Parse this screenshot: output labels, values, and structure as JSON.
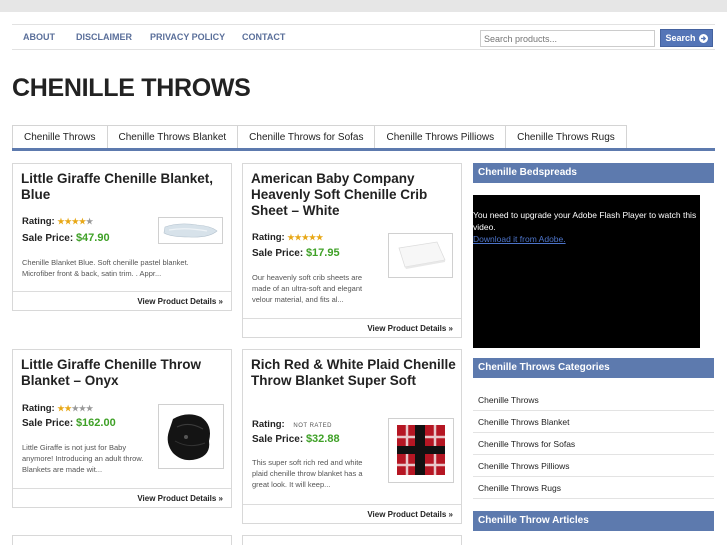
{
  "topnav": {
    "links": [
      "ABOUT",
      "DISCLAIMER",
      "PRIVACY POLICY",
      "CONTACT"
    ]
  },
  "search": {
    "placeholder": "Search products...",
    "button_label": "Search"
  },
  "site_title": "CHENILLE THROWS",
  "categories_nav": [
    "Chenille Throws",
    "Chenille Throws Blanket",
    "Chenille Throws for Sofas",
    "Chenille Throws Pilliows",
    "Chenille Throws Rugs"
  ],
  "products": [
    {
      "title": "Little Giraffe Chenille Blanket, Blue",
      "rating_label": "Rating:",
      "rating": 4,
      "price_label": "Sale Price:",
      "price": "$47.90",
      "description": "Chenille Blanket Blue. Soft chenille pastel blanket. Microfiber front & back, satin trim. . Appr...",
      "link": "View Product Details »"
    },
    {
      "title": "American Baby Company Heavenly Soft Chenille Crib Sheet – White",
      "rating_label": "Rating:",
      "rating": 5,
      "price_label": "Sale Price:",
      "price": "$17.95",
      "description": "Our heavenly soft crib sheets are made of an ultra-soft and elegant velour material, and fits al...",
      "link": "View Product Details »"
    },
    {
      "title": "Little Giraffe Chenille Throw Blanket – Onyx",
      "rating_label": "Rating:",
      "rating": 2,
      "price_label": "Sale Price:",
      "price": "$162.00",
      "description": "Little Giraffe is not just for Baby anymore! Introducing an adult throw. Blankets are made wit...",
      "link": "View Product Details »"
    },
    {
      "title": "Rich Red & White Plaid Chenille Throw Blanket Super Soft",
      "rating_label": "Rating:",
      "rating_text": "NOT RATED",
      "price_label": "Sale Price:",
      "price": "$32.88",
      "description": "This super soft rich red and white plaid chenille throw blanket has a great look. It will keep...",
      "link": "View Product Details »"
    }
  ],
  "sidebar": {
    "bedspreads_title": "Chenille Bedspreads",
    "flash_message": "You need to upgrade your Adobe Flash Player to watch this video.",
    "flash_link": "Download it from Adobe.",
    "categories_title": "Chenille Throws Categories",
    "categories": [
      "Chenille Throws",
      "Chenille Throws Blanket",
      "Chenille Throws for Sofas",
      "Chenille Throws Pilliows",
      "Chenille Throws Rugs"
    ],
    "articles_title": "Chenille Throw Articles"
  },
  "colors": {
    "accent": "#5d7aae",
    "price": "#3fa127",
    "star": "#e8a817"
  }
}
